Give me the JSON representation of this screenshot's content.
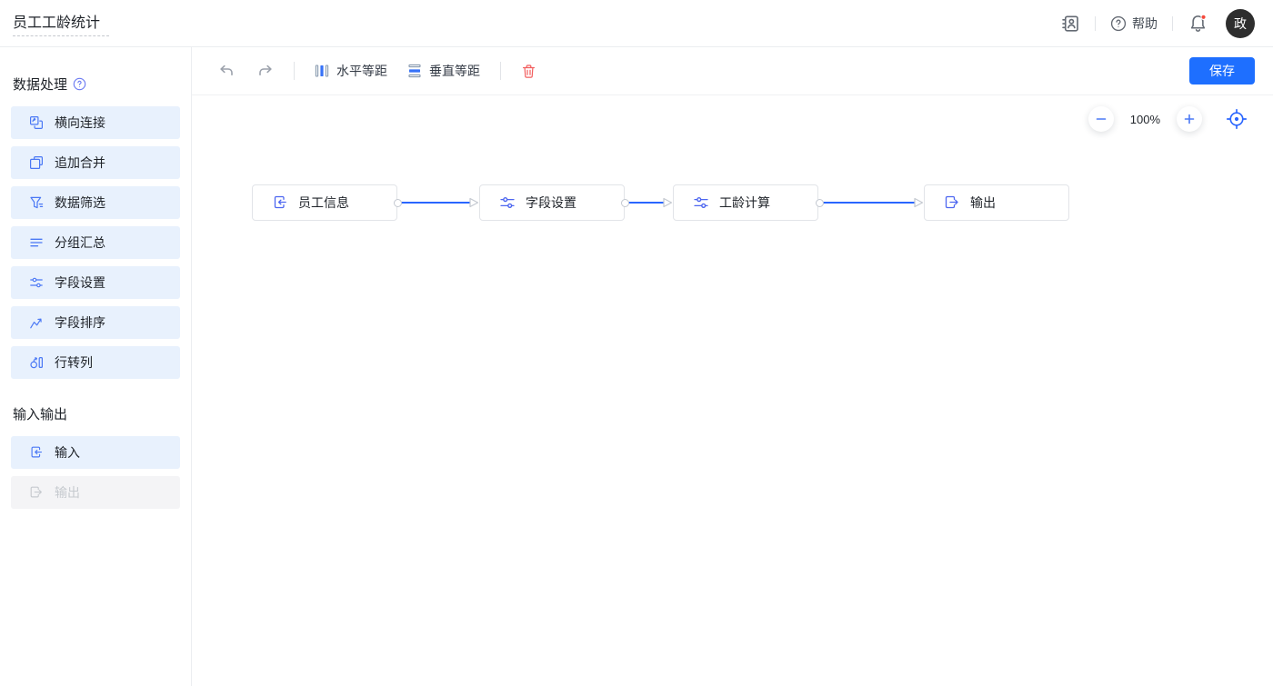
{
  "header": {
    "title": "员工工龄统计",
    "help_label": "帮助",
    "avatar_text": "政",
    "icons": [
      "contacts-icon",
      "help-icon",
      "bell-icon"
    ],
    "notification_dot": true
  },
  "sidebar": {
    "sections": [
      {
        "title": "数据处理",
        "has_help_icon": true,
        "items": [
          {
            "label": "横向连接",
            "icon": "join-icon",
            "disabled": false
          },
          {
            "label": "追加合并",
            "icon": "append-merge-icon",
            "disabled": false
          },
          {
            "label": "数据筛选",
            "icon": "filter-icon",
            "disabled": false
          },
          {
            "label": "分组汇总",
            "icon": "group-summary-icon",
            "disabled": false
          },
          {
            "label": "字段设置",
            "icon": "field-settings-icon",
            "disabled": false
          },
          {
            "label": "字段排序",
            "icon": "field-sort-icon",
            "disabled": false
          },
          {
            "label": "行转列",
            "icon": "row-to-column-icon",
            "disabled": false
          }
        ]
      },
      {
        "title": "输入输出",
        "has_help_icon": false,
        "items": [
          {
            "label": "输入",
            "icon": "input-icon",
            "disabled": false
          },
          {
            "label": "输出",
            "icon": "output-icon",
            "disabled": true
          }
        ]
      }
    ]
  },
  "toolbar": {
    "undo_icon": "undo-icon",
    "redo_icon": "redo-icon",
    "horizontal_spacing_label": "水平等距",
    "vertical_spacing_label": "垂直等距",
    "delete_icon": "trash-icon",
    "save_label": "保存"
  },
  "canvas": {
    "zoom_level": "100%",
    "nodes": [
      {
        "label": "员工信息",
        "icon": "input-icon"
      },
      {
        "label": "字段设置",
        "icon": "field-settings-icon"
      },
      {
        "label": "工龄计算",
        "icon": "field-settings-icon"
      },
      {
        "label": "输出",
        "icon": "output-icon"
      }
    ],
    "connections": [
      {
        "from": "员工信息",
        "to": "字段设置"
      },
      {
        "from": "字段设置",
        "to": "工龄计算"
      },
      {
        "from": "工龄计算",
        "to": "输出"
      }
    ]
  },
  "colors": {
    "accent_blue": "#1e6fff",
    "icon_blue": "#4a78f5",
    "node_icon_blue": "#4d66f0",
    "connection_blue": "#2a66ff",
    "sidebar_item_bg": "#e8f1fd",
    "disabled_bg": "#f4f4f6",
    "danger_red": "#f25d5d",
    "notification_red": "#f5483b",
    "avatar_bg": "#2e2e2e"
  }
}
